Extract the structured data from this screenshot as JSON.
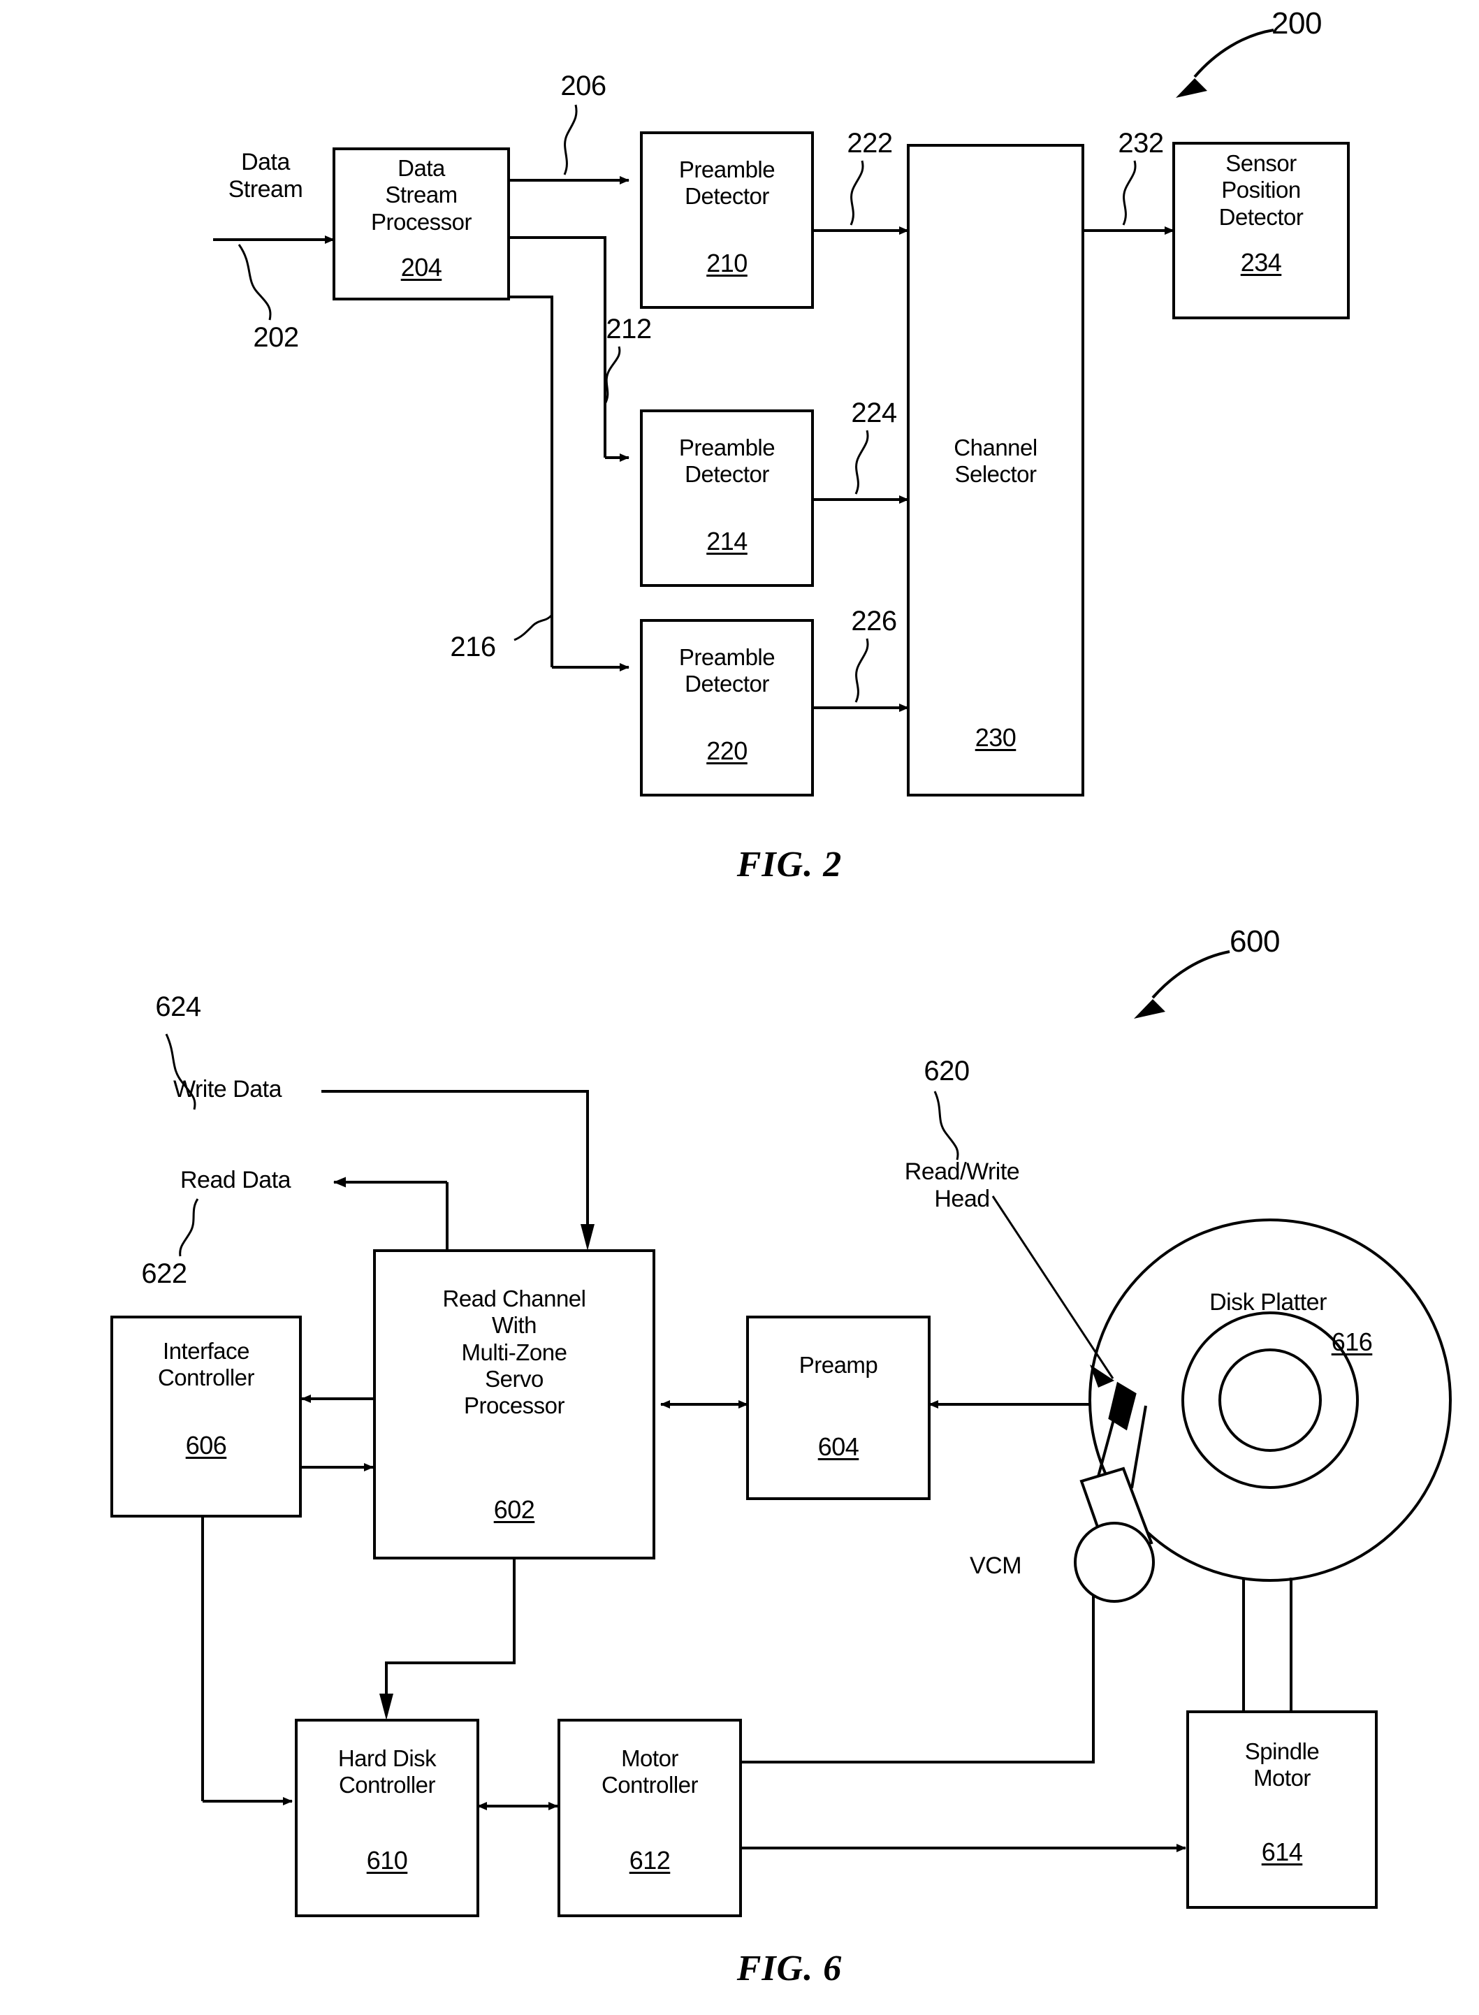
{
  "figures": [
    {
      "id": "fig2",
      "caption": "FIG. 2",
      "system_ref": "200",
      "input_label": "Data\nStream",
      "input_ref": "202",
      "blocks": [
        {
          "name": "data-stream-processor",
          "label": "Data\nStream\nProcessor",
          "ref": "204"
        },
        {
          "name": "preamble-detector-210",
          "label": "Preamble\nDetector",
          "ref": "210"
        },
        {
          "name": "preamble-detector-214",
          "label": "Preamble\nDetector",
          "ref": "214"
        },
        {
          "name": "preamble-detector-220",
          "label": "Preamble\nDetector",
          "ref": "220"
        },
        {
          "name": "channel-selector",
          "label": "Channel\nSelector",
          "ref": "230"
        },
        {
          "name": "sensor-position-detector",
          "label": "Sensor\nPosition\nDetector",
          "ref": "234"
        }
      ],
      "signal_refs": [
        "206",
        "212",
        "216",
        "222",
        "224",
        "226",
        "232"
      ]
    },
    {
      "id": "fig6",
      "caption": "FIG. 6",
      "system_ref": "600",
      "io": [
        {
          "name": "write-data",
          "label": "Write Data",
          "ref": "624"
        },
        {
          "name": "read-data",
          "label": "Read Data",
          "ref": "622"
        }
      ],
      "blocks": [
        {
          "name": "read-channel",
          "label": "Read Channel\nWith\nMulti-Zone\nServo\nProcessor",
          "ref": "602"
        },
        {
          "name": "interface-controller",
          "label": "Interface\nController",
          "ref": "606"
        },
        {
          "name": "preamp",
          "label": "Preamp",
          "ref": "604"
        },
        {
          "name": "hard-disk-controller",
          "label": "Hard Disk\nController",
          "ref": "610"
        },
        {
          "name": "motor-controller",
          "label": "Motor\nController",
          "ref": "612"
        },
        {
          "name": "spindle-motor",
          "label": "Spindle\nMotor",
          "ref": "614"
        }
      ],
      "annotations": [
        {
          "name": "read-write-head",
          "label": "Read/Write\nHead",
          "ref": "620"
        },
        {
          "name": "disk-platter",
          "label": "Disk Platter",
          "ref": "616"
        },
        {
          "name": "vcm",
          "label": "VCM",
          "ref": ""
        }
      ]
    }
  ],
  "fig2": {
    "system_ref": "200",
    "caption": "FIG. 2",
    "data_stream_in": "Data\nStream",
    "ref_202": "202",
    "ref_206": "206",
    "ref_212": "212",
    "ref_216": "216",
    "ref_222": "222",
    "ref_224": "224",
    "ref_226": "226",
    "ref_232": "232",
    "dsp_label": "Data\nStream\nProcessor",
    "dsp_ref": "204",
    "pd1_label": "Preamble\nDetector",
    "pd1_ref": "210",
    "pd2_label": "Preamble\nDetector",
    "pd2_ref": "214",
    "pd3_label": "Preamble\nDetector",
    "pd3_ref": "220",
    "chsel_label": "Channel\nSelector",
    "chsel_ref": "230",
    "spd_label": "Sensor\nPosition\nDetector",
    "spd_ref": "234"
  },
  "fig6": {
    "system_ref": "600",
    "caption": "FIG. 6",
    "write_data": "Write Data",
    "ref_624": "624",
    "read_data": "Read Data",
    "ref_622": "622",
    "rc_label": "Read Channel\nWith\nMulti-Zone\nServo\nProcessor",
    "rc_ref": "602",
    "ic_label": "Interface\nController",
    "ic_ref": "606",
    "preamp_label": "Preamp",
    "preamp_ref": "604",
    "hdc_label": "Hard Disk\nController",
    "hdc_ref": "610",
    "mc_label": "Motor\nController",
    "mc_ref": "612",
    "sm_label": "Spindle\nMotor",
    "sm_ref": "614",
    "rwh_label": "Read/Write\nHead",
    "ref_620": "620",
    "platter_label": "Disk Platter",
    "platter_ref": "616",
    "vcm_label": "VCM"
  }
}
